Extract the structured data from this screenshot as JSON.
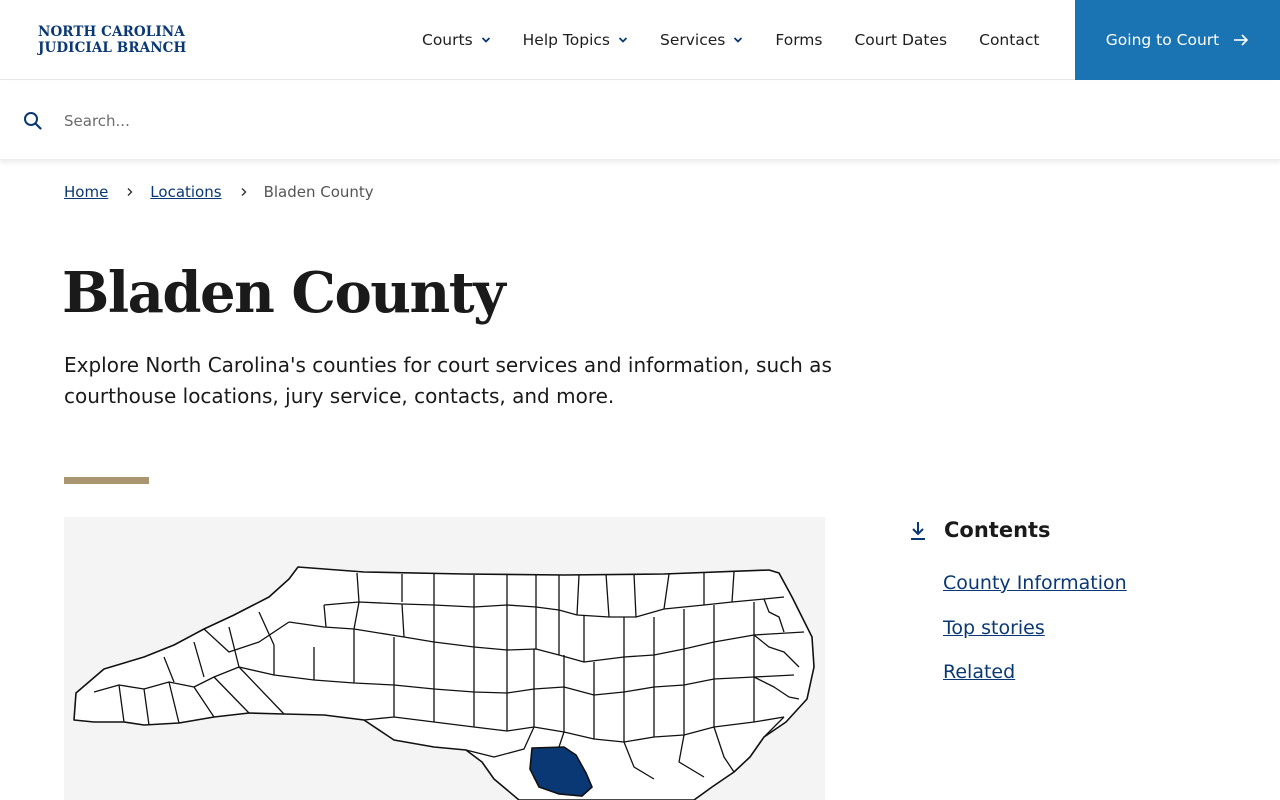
{
  "header": {
    "logo_line1": "NORTH CAROLINA",
    "logo_line2": "JUDICIAL BRANCH",
    "nav": [
      {
        "label": "Courts",
        "dropdown": true,
        "icon": "chevron-down-icon"
      },
      {
        "label": "Help Topics",
        "dropdown": true,
        "icon": "chevron-down-icon"
      },
      {
        "label": "Services",
        "dropdown": true,
        "icon": "chevron-down-icon"
      },
      {
        "label": "Forms",
        "dropdown": false
      },
      {
        "label": "Court Dates",
        "dropdown": false
      },
      {
        "label": "Contact",
        "dropdown": false
      }
    ],
    "cta_label": "Going to Court",
    "cta_icon": "arrow-right-icon"
  },
  "search": {
    "placeholder": "Search...",
    "value": "",
    "icon": "search-icon"
  },
  "breadcrumb": {
    "items": [
      {
        "label": "Home",
        "link": true
      },
      {
        "label": "Locations",
        "link": true
      },
      {
        "label": "Bladen County",
        "link": false
      }
    ],
    "separator_icon": "chevron-right-icon"
  },
  "page": {
    "title": "Bladen County",
    "intro": "Explore North Carolina's counties for court services and information, such as courthouse locations, jury service, contacts, and more."
  },
  "map": {
    "highlighted_county": "Bladen",
    "highlight_color": "#0a3874"
  },
  "contents": {
    "title": "Contents",
    "icon": "arrow-down-to-line-icon",
    "links": [
      "County Information",
      "Top stories",
      "Related"
    ]
  },
  "colors": {
    "brand_navy": "#0a3874",
    "cta_blue": "#1a74b3",
    "accent_tan": "#a99670",
    "map_bg": "#f4f4f4"
  }
}
